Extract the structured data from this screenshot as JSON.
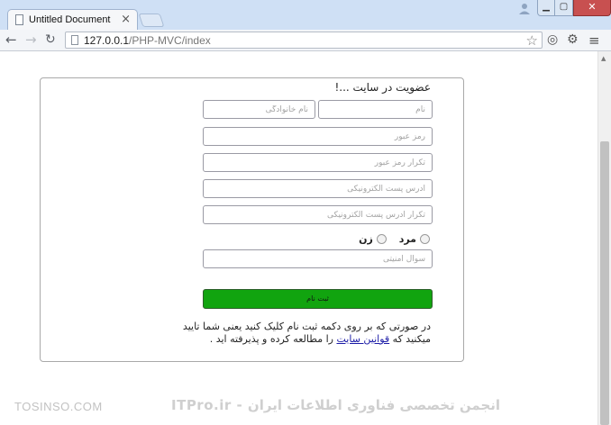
{
  "browser": {
    "tab_title": "Untitled Document",
    "tab_close": "×",
    "url_host": "127.0.0.1",
    "url_path": "/PHP-MVC/index",
    "close_glyph": "✕"
  },
  "form": {
    "title": "عضویت در سایت ...!",
    "first_name_placeholder": "نام",
    "last_name_placeholder": "نام خانوادگی",
    "password_placeholder": "رمز عبور",
    "password_repeat_placeholder": "تکرار رمز عبور",
    "email_placeholder": "آدرس پست الکترونیکی",
    "email_repeat_placeholder": "تکرار آدرس پست الکترونیکی",
    "gender_male": "مرد",
    "gender_female": "زن",
    "security_question_placeholder": "سوال امنیتی",
    "submit_label": "ثبت نام",
    "terms_before": "در صورتی که بر روی دکمه ثبت نام کلیک کنید یعنی شما تایید میکنید که ",
    "terms_link": "قوانین سایت",
    "terms_after": " را مطالعه کرده و پذیرفته اید ."
  },
  "watermark": {
    "left": "TOSINSO.COM",
    "right": "ITPro.ir - انجمن تخصصی فناوری اطلاعات ایران"
  }
}
